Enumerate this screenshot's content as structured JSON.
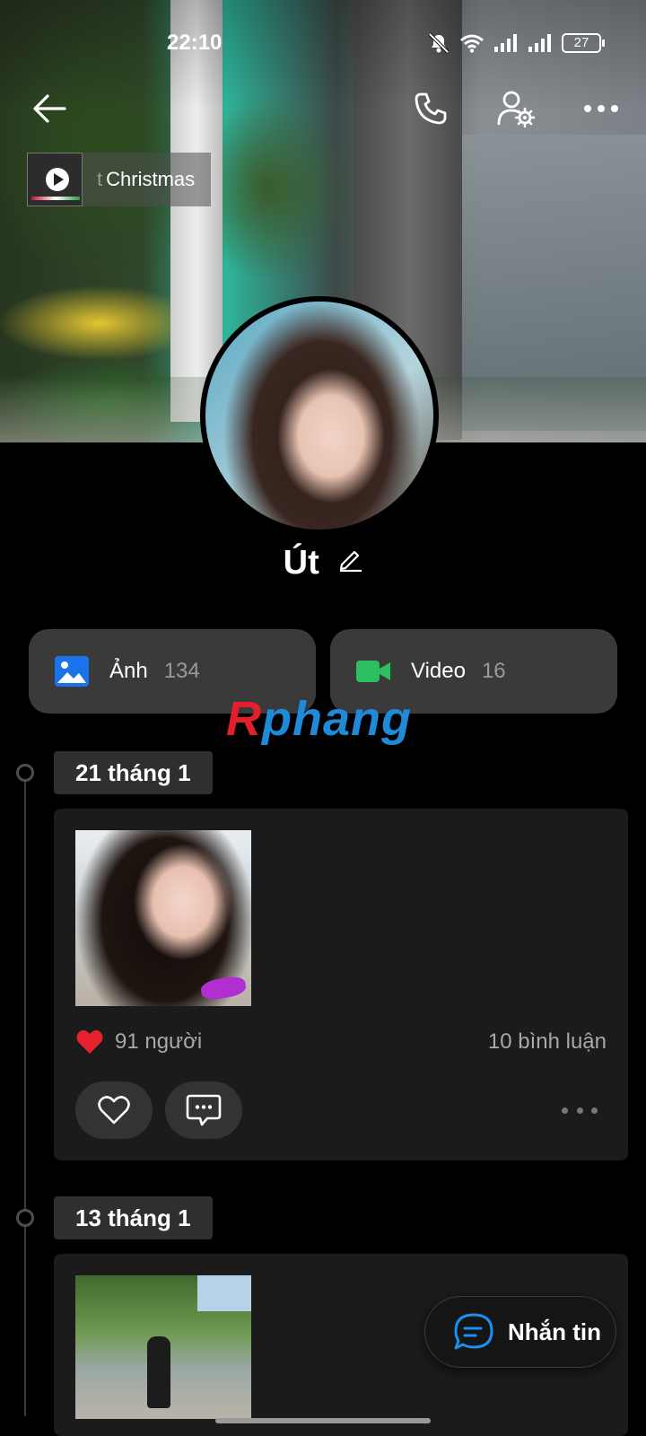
{
  "status_bar": {
    "time": "22:10",
    "battery": "27",
    "icons": [
      "mute-bell-icon",
      "wifi-icon",
      "signal-icon",
      "signal-icon",
      "battery-icon"
    ]
  },
  "header": {
    "icons": [
      "back-arrow-icon",
      "phone-icon",
      "user-settings-icon",
      "more-dots-icon"
    ]
  },
  "music": {
    "title_fade": "t",
    "title": "Christmas"
  },
  "profile": {
    "name": "Út"
  },
  "media": {
    "photos_label": "Ảnh",
    "photos_count": "134",
    "video_label": "Video",
    "video_count": "16",
    "photo_icon_color": "#1a73e8",
    "video_icon_color": "#2bbf5f"
  },
  "watermark": {
    "first": "R",
    "rest": "phang"
  },
  "timeline": [
    {
      "date": "21 tháng 1",
      "likes": "91 người",
      "comments": "10 bình luận"
    },
    {
      "date": "13 tháng 1"
    }
  ],
  "message_button": {
    "label": "Nhắn tin"
  }
}
